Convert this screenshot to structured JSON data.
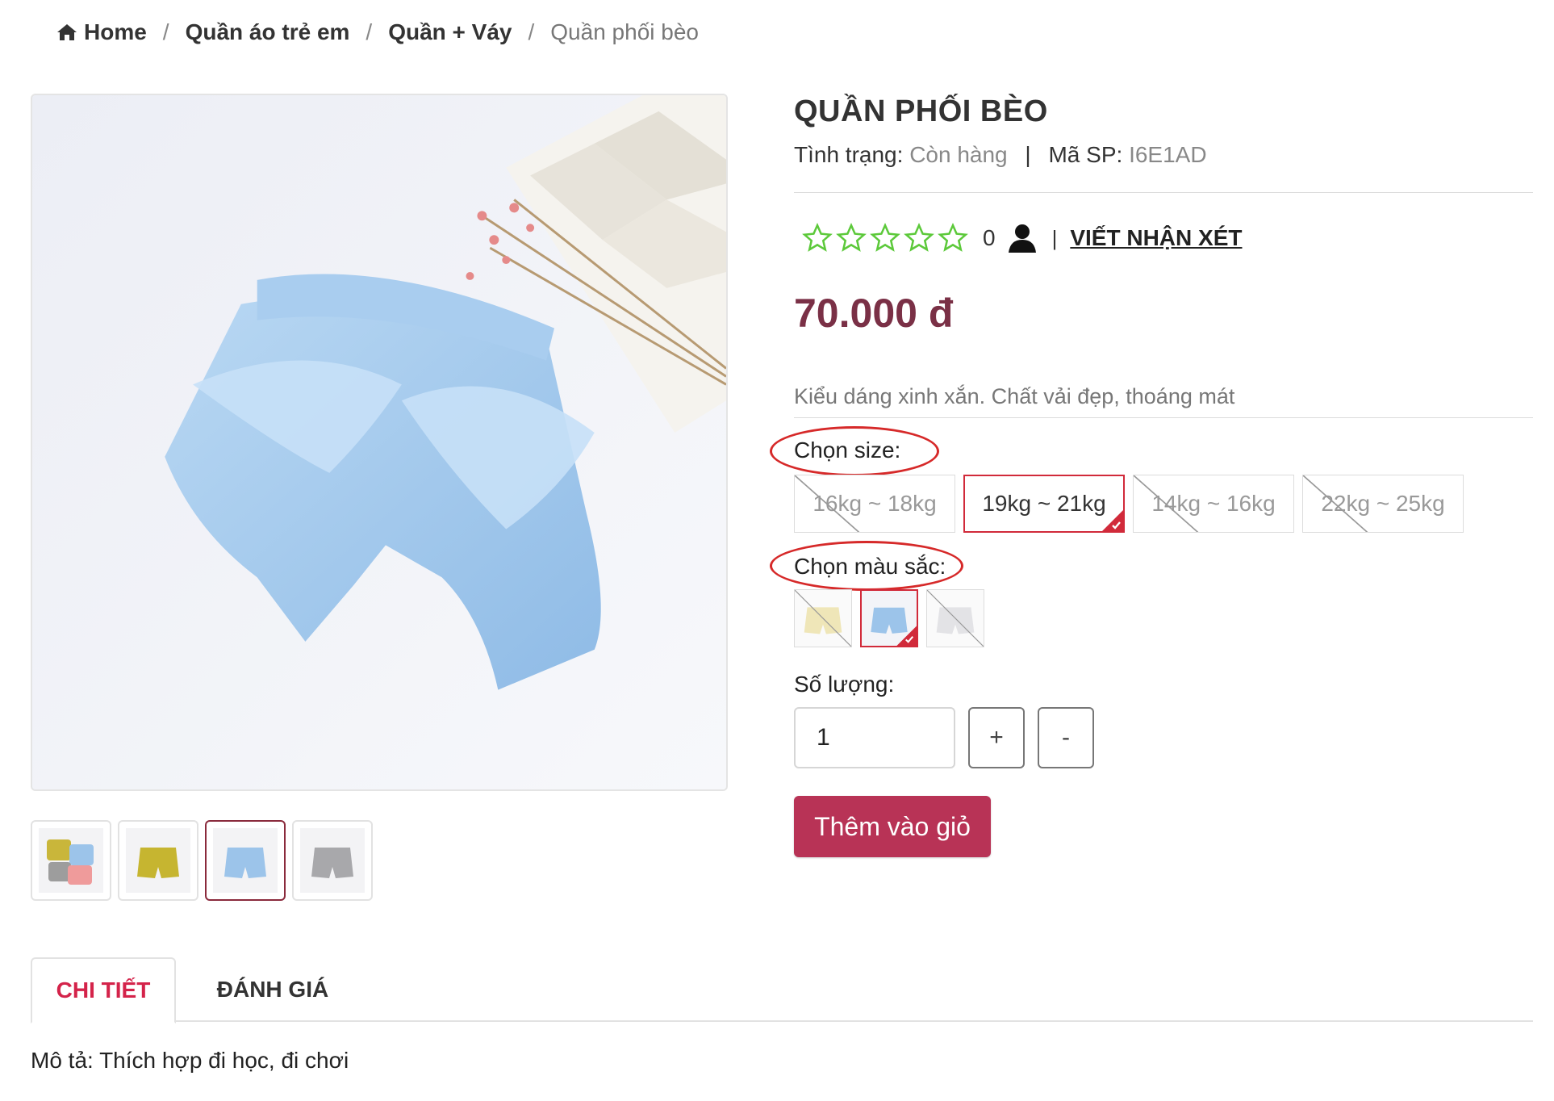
{
  "breadcrumb": {
    "home": "Home",
    "items": [
      "Quần áo trẻ em",
      "Quần + Váy"
    ],
    "current": "Quần phối bèo",
    "separator": "/"
  },
  "product": {
    "title": "QUẦN PHỐI BÈO",
    "status_label": "Tình trạng:",
    "status_value": "Còn hàng",
    "sku_label": "Mã SP:",
    "sku_value": "I6E1AD",
    "meta_separator": "|",
    "rating_count": "0",
    "rating_separator": "|",
    "write_review": "VIẾT NHẬN XÉT",
    "price": "70.000 đ",
    "short_description": "Kiểu dáng xinh xắn. Chất vải đẹp, thoáng mát"
  },
  "options": {
    "size_label": "Chọn size:",
    "sizes": [
      {
        "label": "16kg ~ 18kg",
        "state": "unavailable"
      },
      {
        "label": "19kg ~ 21kg",
        "state": "selected"
      },
      {
        "label": "14kg ~ 16kg",
        "state": "unavailable"
      },
      {
        "label": "22kg ~ 25kg",
        "state": "unavailable"
      }
    ],
    "color_label": "Chọn màu sắc:",
    "colors": [
      {
        "name": "yellow-shorts-swatch",
        "state": "unavailable"
      },
      {
        "name": "blue-shorts-swatch",
        "state": "selected"
      },
      {
        "name": "grey-shorts-swatch",
        "state": "unavailable"
      }
    ],
    "quantity_label": "Số lượng:",
    "quantity_value": "1",
    "plus_label": "+",
    "minus_label": "-"
  },
  "cart": {
    "add_to_cart": "Thêm vào giỏ"
  },
  "tabs": {
    "details": "CHI TIẾT",
    "reviews": "ĐÁNH GIÁ"
  },
  "description": "Mô tả: Thích hợp đi học, đi chơi",
  "colors": {
    "accent": "#d12a3a",
    "price": "#7a3046",
    "button": "#b83356",
    "star": "#5cc93a",
    "tab_active": "#d4234a",
    "annotation_oval": "#d62929"
  }
}
